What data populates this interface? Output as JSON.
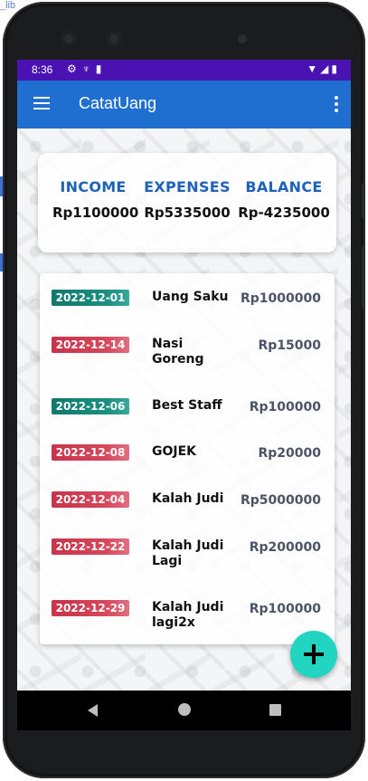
{
  "desktop": {
    "link_text": "_lib"
  },
  "statusbar": {
    "time": "8:36",
    "left_icons": [
      "gear-icon",
      "usb-icon",
      "sd-card-icon"
    ],
    "right_icons": [
      "wifi-icon",
      "signal-icon",
      "battery-icon"
    ]
  },
  "appbar": {
    "title": "CatatUang",
    "bg_color": "#1f6fd0"
  },
  "summary": [
    {
      "label": "INCOME",
      "value": "Rp1100000"
    },
    {
      "label": "EXPENSES",
      "value": "Rp5335000"
    },
    {
      "label": "BALANCE",
      "value": "Rp-4235000"
    }
  ],
  "transactions": [
    {
      "date": "2022-12-01",
      "type": "income",
      "name": "Uang Saku",
      "amount": "Rp1000000"
    },
    {
      "date": "2022-12-14",
      "type": "expense",
      "name": "Nasi Goreng",
      "amount": "Rp15000"
    },
    {
      "date": "2022-12-06",
      "type": "income",
      "name": "Best Staff",
      "amount": "Rp100000"
    },
    {
      "date": "2022-12-08",
      "type": "expense",
      "name": "GOJEK",
      "amount": "Rp20000"
    },
    {
      "date": "2022-12-04",
      "type": "expense",
      "name": "Kalah Judi",
      "amount": "Rp5000000"
    },
    {
      "date": "2022-12-22",
      "type": "expense",
      "name": "Kalah Judi Lagi",
      "amount": "Rp200000"
    },
    {
      "date": "2022-12-29",
      "type": "expense",
      "name": "Kalah Judi lagi2x",
      "amount": "Rp100000"
    }
  ],
  "colors": {
    "income": "#11796c",
    "expense": "#c8334a",
    "fab": "#22d5c1",
    "statusbar": "#4b12b3"
  }
}
